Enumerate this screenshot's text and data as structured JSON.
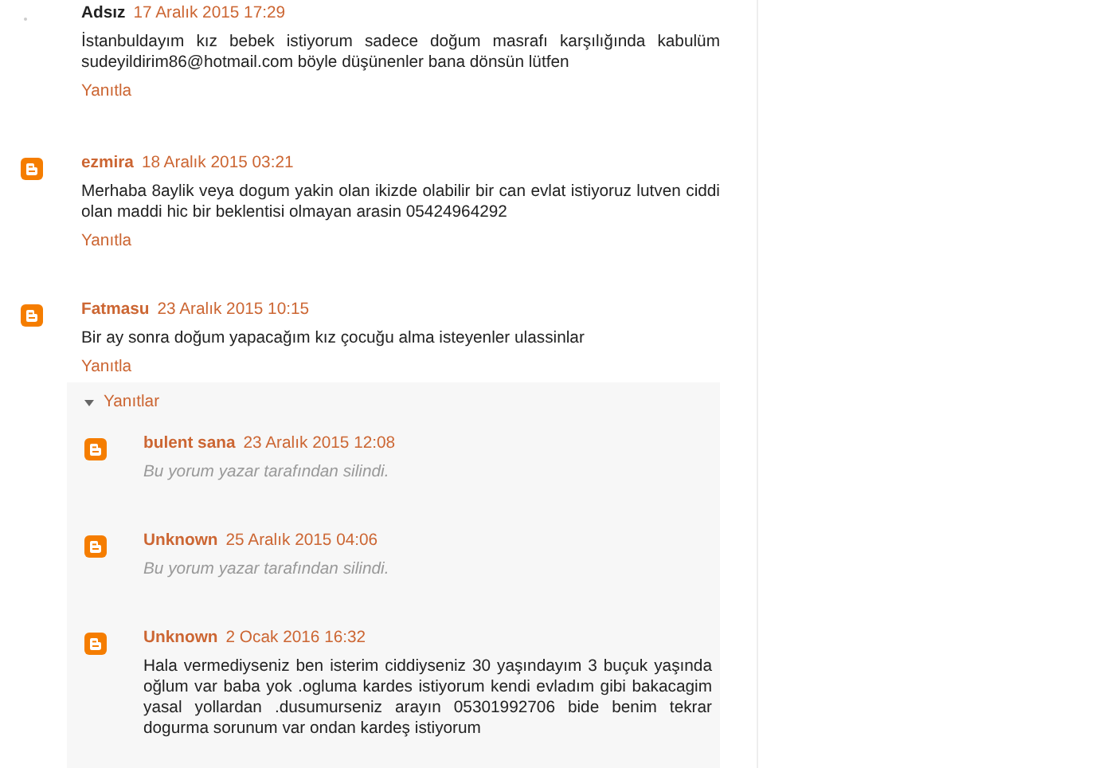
{
  "comments": [
    {
      "author": "Adsız",
      "anonymous": true,
      "date": "17 Aralık 2015 17:29",
      "text": "İstanbuldayım kız bebek istiyorum sadece doğum masrafı karşılığında kabulüm sudeyildirim86@hotmail.com böyle düşünenler bana dönsün lütfen",
      "reply_link": "Yanıtla"
    },
    {
      "author": "ezmira",
      "anonymous": false,
      "date": "18 Aralık 2015 03:21",
      "text": "Merhaba 8aylik veya dogum yakin olan ikizde olabilir bir can evlat istiyoruz lutven ciddi olan maddi hic bir beklentisi olmayan arasin 05424964292",
      "reply_link": "Yanıtla"
    },
    {
      "author": "Fatmasu",
      "anonymous": false,
      "date": "23 Aralık 2015 10:15",
      "text": "Bir ay sonra doğum yapacağım kız çocuğu alma isteyenler ulassinlar",
      "reply_link": "Yanıtla",
      "replies": {
        "label": "Yanıtlar",
        "expanded": true,
        "items": [
          {
            "author": "bulent sana",
            "date": "23 Aralık 2015 12:08",
            "text": "Bu yorum yazar tarafından silindi.",
            "deleted": true
          },
          {
            "author": "Unknown",
            "date": "25 Aralık 2015 04:06",
            "text": "Bu yorum yazar tarafından silindi.",
            "deleted": true
          },
          {
            "author": "Unknown",
            "date": "2 Ocak 2016 16:32",
            "text": "Hala vermediyseniz ben isterim ciddiyseniz 30 yaşındayım 3 buçuk yaşında oğlum var baba yok .ogluma kardes istiyorum kendi evladım gibi bakacagim yasal yollardan .dusumurseniz arayın 05301992706 bide benim tekrar dogurma sorunum var ondan kardeş istiyorum",
            "deleted": false
          }
        ]
      }
    }
  ]
}
